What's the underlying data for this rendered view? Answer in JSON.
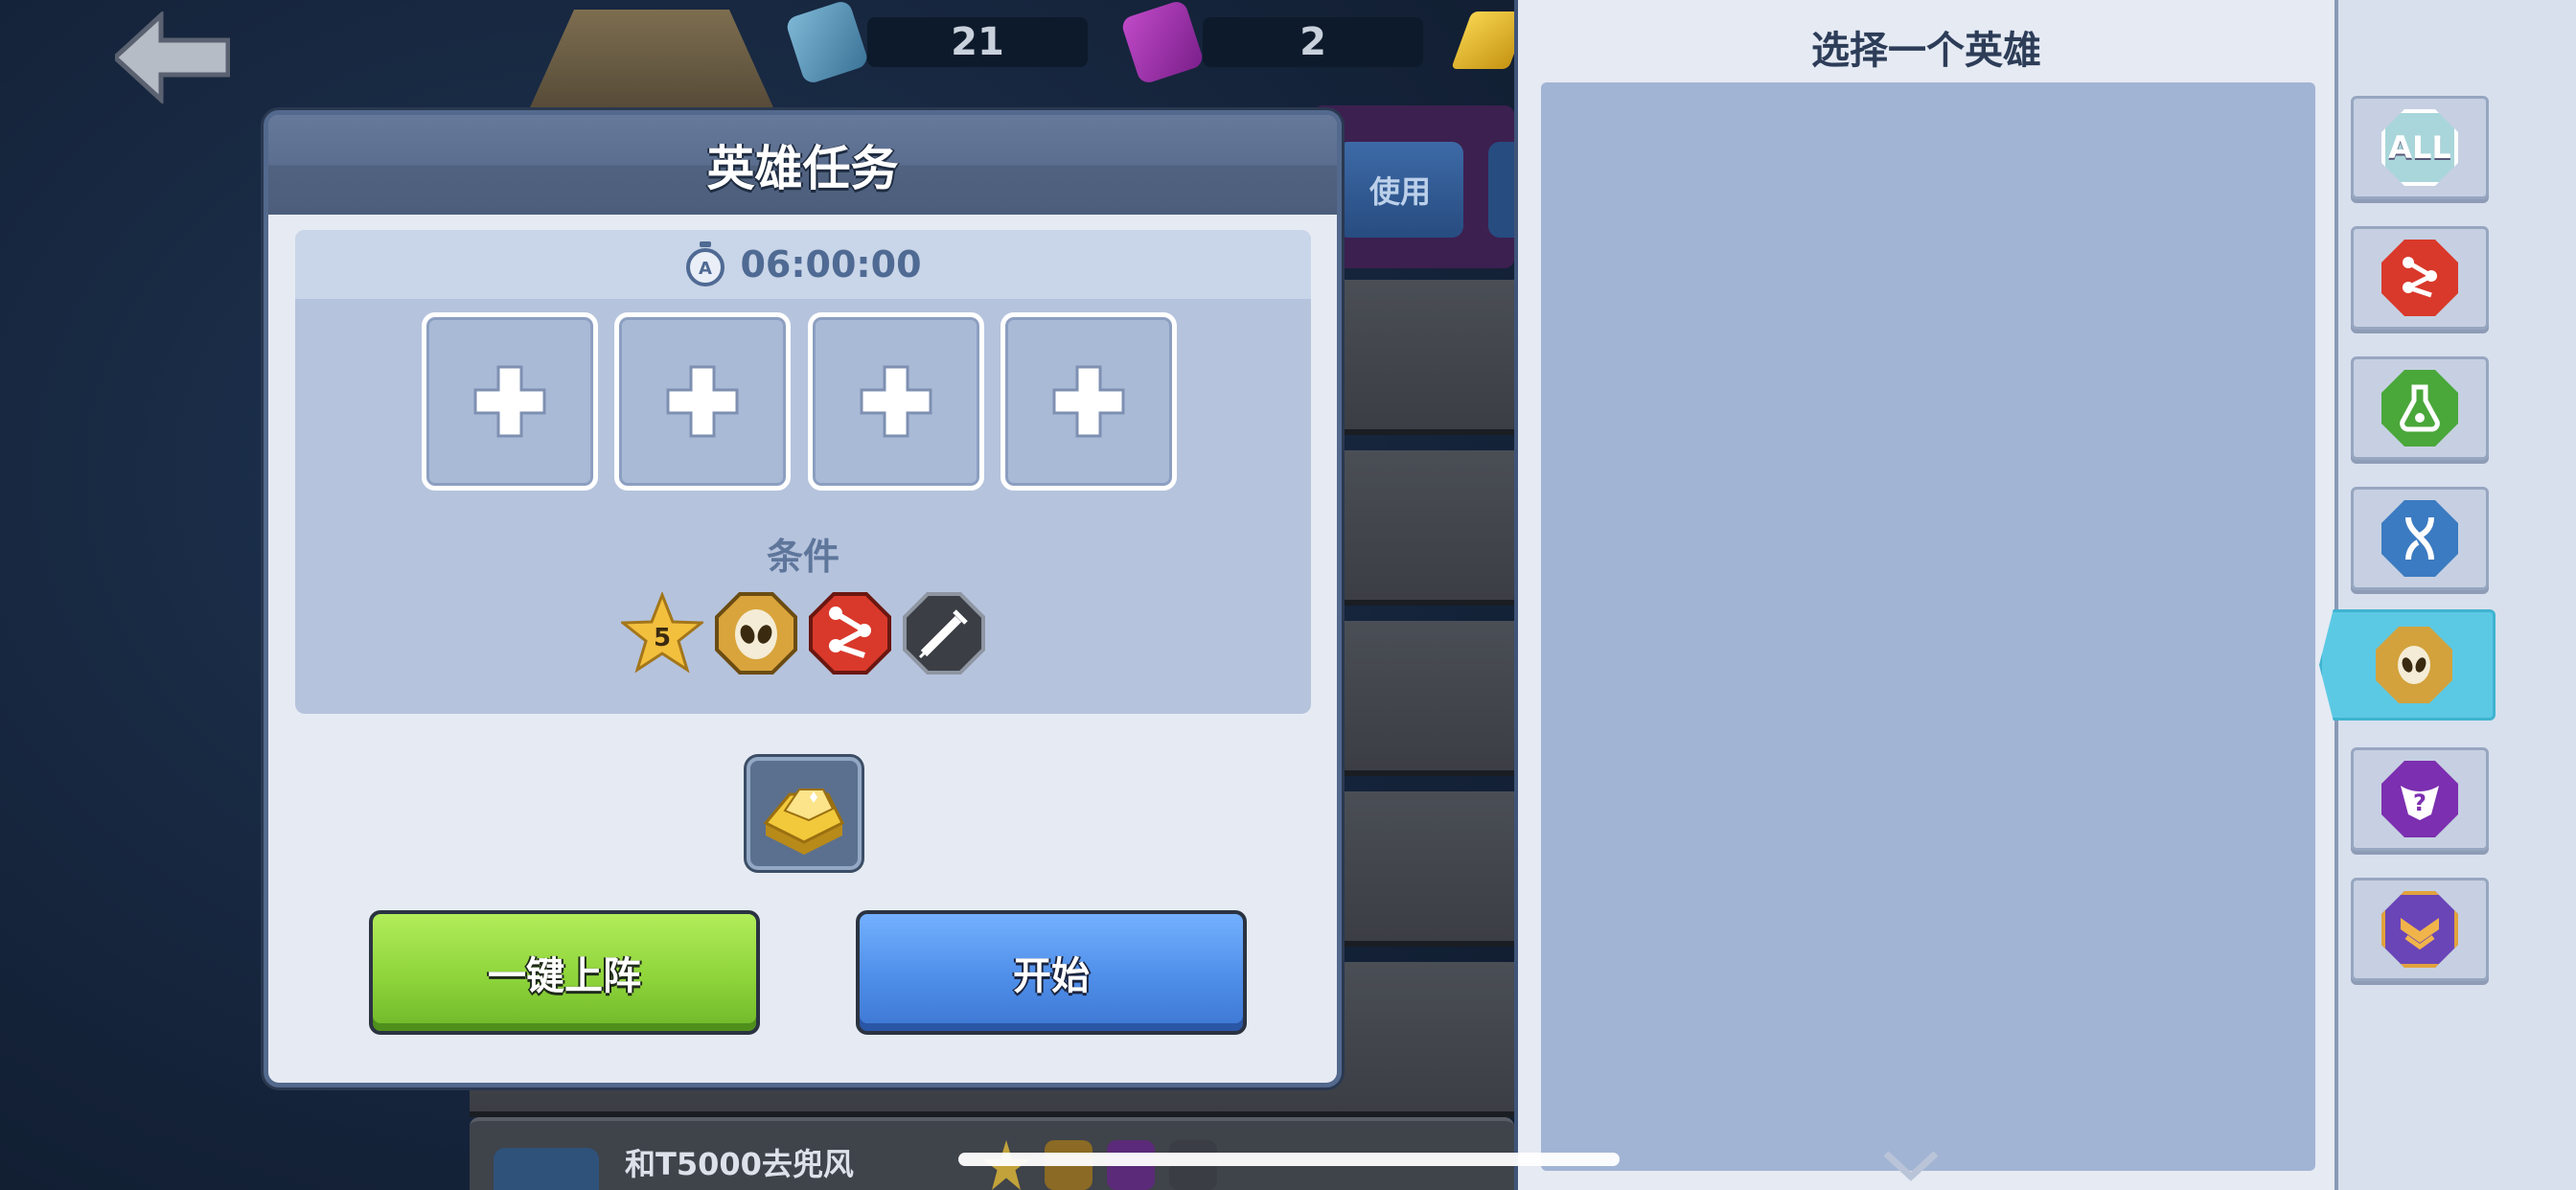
{
  "top_bar": {
    "back_label": "back",
    "currency_1": {
      "icon": "blue-book-icon",
      "value": "21"
    },
    "currency_2": {
      "icon": "purple-book-icon",
      "value": "2"
    },
    "use_button_label": "使用"
  },
  "background_list": {
    "bottom_item_title": "和T5000去兜风"
  },
  "modal": {
    "title": "英雄任务",
    "timer": "06:00:00",
    "slots": [
      "empty",
      "empty",
      "empty",
      "empty"
    ],
    "condition_label": "条件",
    "conditions": [
      {
        "icon": "star-icon",
        "value": "5"
      },
      {
        "icon": "alien-icon"
      },
      {
        "icon": "nodes-icon"
      },
      {
        "icon": "syringe-icon"
      }
    ],
    "reward": {
      "icon": "gold-bar-icon"
    },
    "auto_deploy_label": "一键上阵",
    "start_label": "开始"
  },
  "hero_select": {
    "title": "选择一个英雄",
    "filters": [
      {
        "id": "all",
        "label": "ALL",
        "color": "#a9d6da"
      },
      {
        "id": "nodes",
        "icon": "nodes-icon",
        "color": "#d9392b"
      },
      {
        "id": "flask",
        "icon": "flask-icon",
        "color": "#4aa73a"
      },
      {
        "id": "dna",
        "icon": "dna-icon",
        "color": "#3b7bc2"
      },
      {
        "id": "alien",
        "icon": "alien-icon",
        "color": "#d3a23c",
        "active": true
      },
      {
        "id": "mystery",
        "icon": "mystery-icon",
        "color": "#7c2fb0"
      },
      {
        "id": "rank",
        "icon": "rank-icon",
        "color": "#6a45b8"
      }
    ]
  },
  "colors": {
    "accent_active_tab": "#5cc9e4",
    "green_button": "#8ed43a",
    "blue_button": "#4e8ee8"
  }
}
